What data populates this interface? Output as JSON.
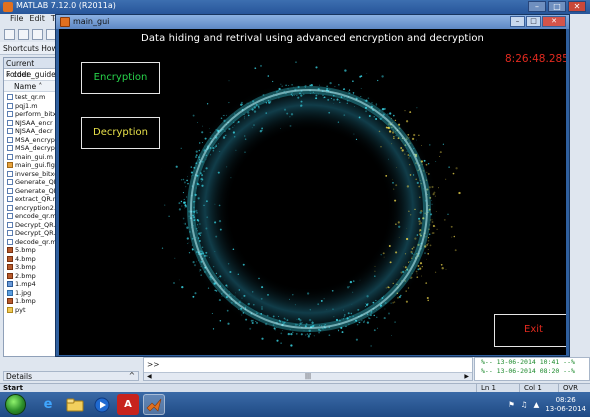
{
  "matlab": {
    "title": "MATLAB 7.12.0 (R2011a)",
    "menu": [
      "File",
      "Edit",
      "Text"
    ],
    "shortcuts": "Shortcuts  How",
    "current_folder": {
      "header": "Current Folder",
      "path": "« code_guide",
      "column_name": "Name ˄",
      "files": [
        {
          "name": "test_qr.m",
          "type": "m"
        },
        {
          "name": "pqj1.m",
          "type": "m"
        },
        {
          "name": "perform_bitxor",
          "type": "m"
        },
        {
          "name": "NJSAA_encr",
          "type": "m"
        },
        {
          "name": "NJSAA_decr",
          "type": "m"
        },
        {
          "name": "MSA_encrypt",
          "type": "m"
        },
        {
          "name": "MSA_decrypt",
          "type": "m"
        },
        {
          "name": "main_gui.m",
          "type": "m"
        },
        {
          "name": "main_gui.fig",
          "type": "fig"
        },
        {
          "name": "inverse_bitxor",
          "type": "m"
        },
        {
          "name": "Generate_QR",
          "type": "m"
        },
        {
          "name": "Generate_QR",
          "type": "m"
        },
        {
          "name": "extract_QR.m",
          "type": "m"
        },
        {
          "name": "encryption2.m",
          "type": "m"
        },
        {
          "name": "encode_qr.m",
          "type": "m"
        },
        {
          "name": "Decrypt_QR.m",
          "type": "m"
        },
        {
          "name": "Decrypt_QR.m",
          "type": "m"
        },
        {
          "name": "decode_qr.m",
          "type": "m"
        },
        {
          "name": "5.bmp",
          "type": "bmp"
        },
        {
          "name": "4.bmp",
          "type": "bmp"
        },
        {
          "name": "3.bmp",
          "type": "bmp"
        },
        {
          "name": "2.bmp",
          "type": "bmp"
        },
        {
          "name": "1.mp4",
          "type": "mp4"
        },
        {
          "name": "1.jpg",
          "type": "jpg"
        },
        {
          "name": "1.bmp",
          "type": "bmp"
        },
        {
          "name": "pyt",
          "type": "folder"
        }
      ]
    },
    "details_label": "Details",
    "command_prompt": ">>",
    "history": [
      "%-- 13-06-2014 10:41 --%",
      "%-- 13-06-2014 08:20 --%"
    ],
    "start_label": "Start",
    "status": {
      "ln": "Ln 1",
      "col": "Col 1",
      "mode": "OVR"
    }
  },
  "gui": {
    "window_title": "main_gui",
    "header": "Data hiding and retrival using advanced encryption and decryption",
    "clock": "8:26:48.285",
    "buttons": {
      "encryption": "Encryption",
      "decryption": "Decryption",
      "exit": "Exit"
    }
  },
  "colors": {
    "encryption_text": "#27d34a",
    "decryption_text": "#e8e14a",
    "clock_text": "#e12a1f",
    "exit_text": "#e12a1f",
    "ring_primary": "#3ad8e8",
    "ring_secondary": "#e8d24a"
  },
  "taskbar": {
    "apps": [
      "windows-orb-icon",
      "internet-explorer-icon",
      "explorer-icon",
      "media-player-icon",
      "acrobat-icon",
      "matlab-icon"
    ],
    "time": "08:26",
    "date": "13-06-2014"
  }
}
